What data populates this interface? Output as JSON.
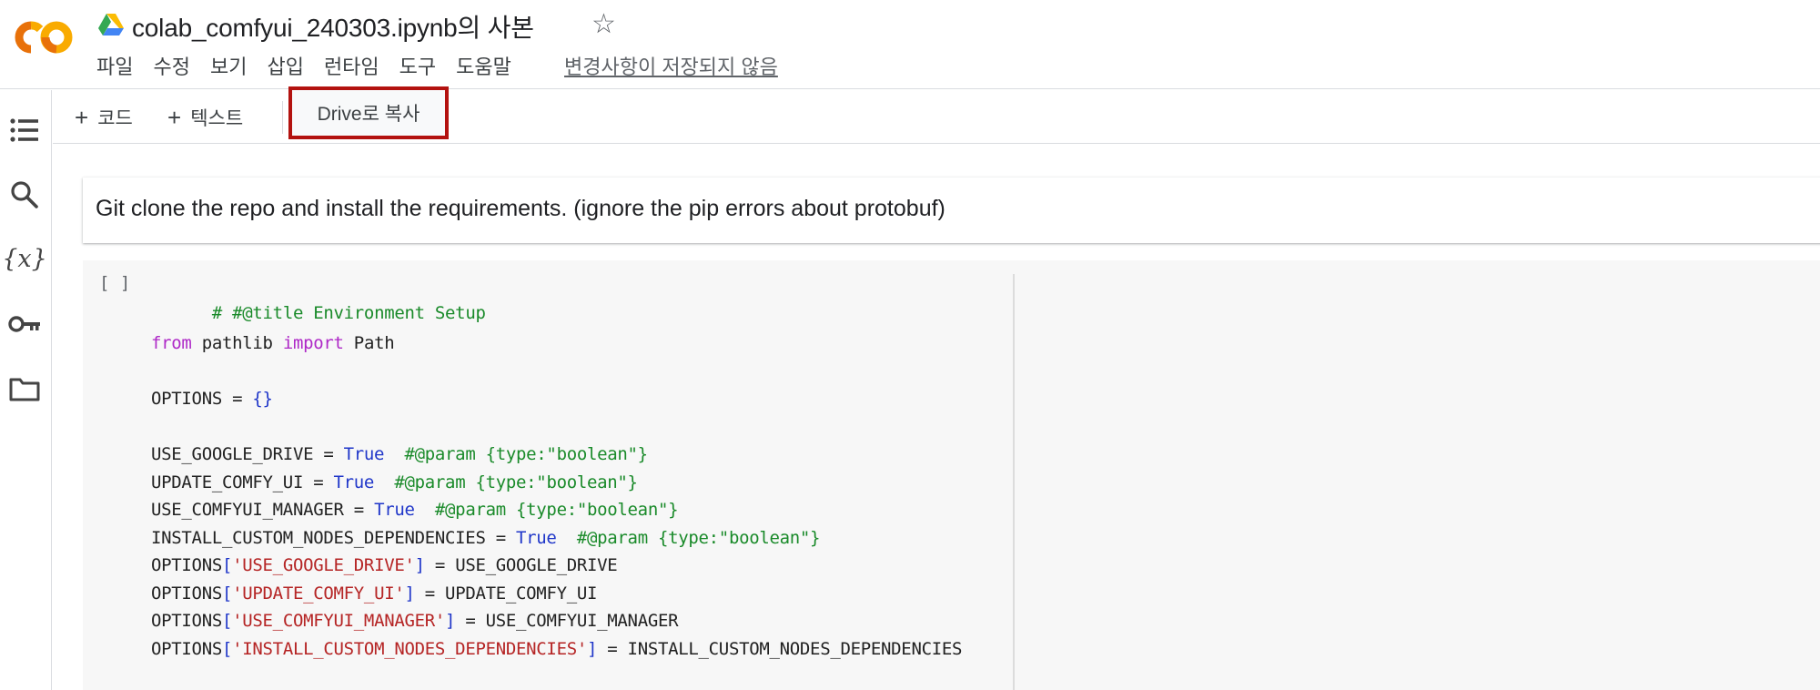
{
  "header": {
    "title": "colab_comfyui_240303.ipynb의 사본",
    "menu": [
      "파일",
      "수정",
      "보기",
      "삽입",
      "런타임",
      "도구",
      "도움말"
    ],
    "unsaved_notice": "변경사항이 저장되지 않음",
    "logo_text": "CO"
  },
  "toolbar": {
    "add_code": "코드",
    "add_text": "텍스트",
    "copy_to_drive": "Drive로 복사"
  },
  "rail_icons": [
    "table-of-contents-icon",
    "search-icon",
    "variables-icon",
    "secrets-key-icon",
    "files-folder-icon"
  ],
  "text_cell": {
    "content": "Git clone the repo and install the requirements. (ignore the pip errors about protobuf)"
  },
  "code_cell": {
    "run_indicator": "[ ]",
    "lines": {
      "l1": "# #@title Environment Setup",
      "l3_kw1": "from",
      "l3_mid": " pathlib ",
      "l3_kw2": "import",
      "l3_end": " Path",
      "l5_a": "OPTIONS = ",
      "l5_b": "{}",
      "l7_a": "USE_GOOGLE_DRIVE = ",
      "l7_b": "True",
      "l7_c": "  #@param {type:\"boolean\"}",
      "l8_a": "UPDATE_COMFY_UI = ",
      "l8_b": "True",
      "l8_c": "  #@param {type:\"boolean\"}",
      "l9_a": "USE_COMFYUI_MANAGER = ",
      "l9_b": "True",
      "l9_c": "  #@param {type:\"boolean\"}",
      "l10_a": "INSTALL_CUSTOM_NODES_DEPENDENCIES = ",
      "l10_b": "True",
      "l10_c": "  #@param {type:\"boolean\"}",
      "l11_a": "OPTIONS",
      "l11_b": "[",
      "l11_c": "'USE_GOOGLE_DRIVE'",
      "l11_d": "]",
      "l11_e": " = USE_GOOGLE_DRIVE",
      "l12_a": "OPTIONS",
      "l12_b": "[",
      "l12_c": "'UPDATE_COMFY_UI'",
      "l12_d": "]",
      "l12_e": " = UPDATE_COMFY_UI",
      "l13_a": "OPTIONS",
      "l13_b": "[",
      "l13_c": "'USE_COMFYUI_MANAGER'",
      "l13_d": "]",
      "l13_e": " = USE_COMFYUI_MANAGER",
      "l14_a": "OPTIONS",
      "l14_b": "[",
      "l14_c": "'INSTALL_CUSTOM_NODES_DEPENDENCIES'",
      "l14_d": "]",
      "l14_e": " = INSTALL_CUSTOM_NODES_DEPENDENCIES"
    }
  },
  "colors": {
    "accent_highlight": "#b3120f",
    "logo_orange": "#f9ab00",
    "logo_dark_orange": "#e8710a",
    "comment": "#198a29",
    "keyword": "#ae28c7",
    "boolean": "#1f36c9",
    "string": "#b52424"
  }
}
